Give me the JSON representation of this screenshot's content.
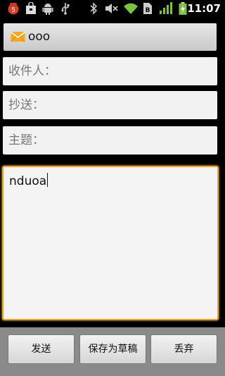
{
  "status_bar": {
    "time": "11:07",
    "notification_badge": "5",
    "icons": [
      "notification-app-icon",
      "shopping-bag-icon",
      "android-icon",
      "usb-icon",
      "bluetooth-icon",
      "mute-icon",
      "wifi-icon",
      "sim-icon",
      "signal-icon",
      "battery-icon"
    ]
  },
  "title_bar": {
    "title": "ooo",
    "icon": "mail-icon"
  },
  "compose": {
    "to_label": "收件人：",
    "cc_label": "抄送：",
    "subject_label": "主题：",
    "body_text": "nduoa"
  },
  "actions": {
    "send": "发送",
    "save_draft": "保存为草稿",
    "discard": "丢弃"
  },
  "colors": {
    "accent_focus": "#f0a030",
    "battery": "#7bc242"
  }
}
